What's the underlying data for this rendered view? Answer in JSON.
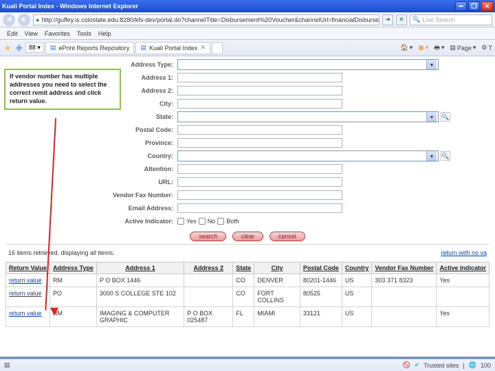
{
  "window": {
    "title": "Kuali Portal Index - Windows Internet Explorer"
  },
  "nav": {
    "url": "http://guffey.is.colostate.edu:8280/kfs-dev/portal.do?channelTitle=Disbursement%20Voucher&channelUrl=financialDisbursem",
    "search_placeholder": "Live Search"
  },
  "menu": {
    "items": [
      "Edit",
      "View",
      "Favorites",
      "Tools",
      "Help"
    ]
  },
  "tabs": {
    "items": [
      {
        "label": "ePrint Reports Repository"
      },
      {
        "label": "Kuali Portal Index"
      }
    ],
    "tools": {
      "home": "▾",
      "feeds": "▾",
      "print": "▾",
      "page_label": "Page",
      "tools_label": "T"
    }
  },
  "callout": {
    "text": "If vendor number has multiple addresses you need to select the correct remit address and click return value."
  },
  "form": {
    "labels": {
      "address_type": "Address Type:",
      "address1": "Address 1:",
      "address2": "Address 2:",
      "city": "City:",
      "state": "State:",
      "postal": "Postal Code:",
      "province": "Province:",
      "country": "Country:",
      "attention": "Attention:",
      "url": "URL:",
      "fax": "Vendor Fax Number:",
      "email": "Email Address:",
      "active": "Active Indicator:"
    },
    "active": {
      "yes": "Yes",
      "no": "No",
      "both": "Both"
    },
    "buttons": {
      "search": "search",
      "clear": "clear",
      "cancel": "cancel"
    }
  },
  "list": {
    "summary": "16 items retrieved, displaying all items.",
    "return_no_value": "return with no va"
  },
  "table": {
    "headers": {
      "return_value": "Return Value",
      "address_type": "Address Type",
      "address1": "Address 1",
      "address2": "Address 2",
      "state": "State",
      "city": "City",
      "postal": "Postal Code",
      "country": "Country",
      "fax": "Vendor Fax Number",
      "active": "Active Indicator"
    },
    "rows": [
      {
        "rv": "return value",
        "atype": "RM",
        "a1": "P O BOX 1446",
        "a2": "",
        "state": "CO",
        "city": "DENVER",
        "postal": "80201-1446",
        "country": "US",
        "fax": "303 371 8323",
        "active": "Yes"
      },
      {
        "rv": "return value",
        "atype": "PO",
        "a1": "3000 S COLLEGE STE 102",
        "a2": "",
        "state": "CO",
        "city": "FORT COLLINS",
        "postal": "80525",
        "country": "US",
        "fax": "",
        "active": ""
      },
      {
        "rv": "return value",
        "atype": "RM",
        "a1": "IMAGING & COMPUTER GRAPHIC",
        "a2": "P O BOX 025487",
        "state": "FL",
        "city": "MIAMI",
        "postal": "33121",
        "country": "US",
        "fax": "",
        "active": "Yes"
      }
    ]
  },
  "status": {
    "done": "",
    "trusted": "Trusted sites",
    "zoom": "100"
  }
}
